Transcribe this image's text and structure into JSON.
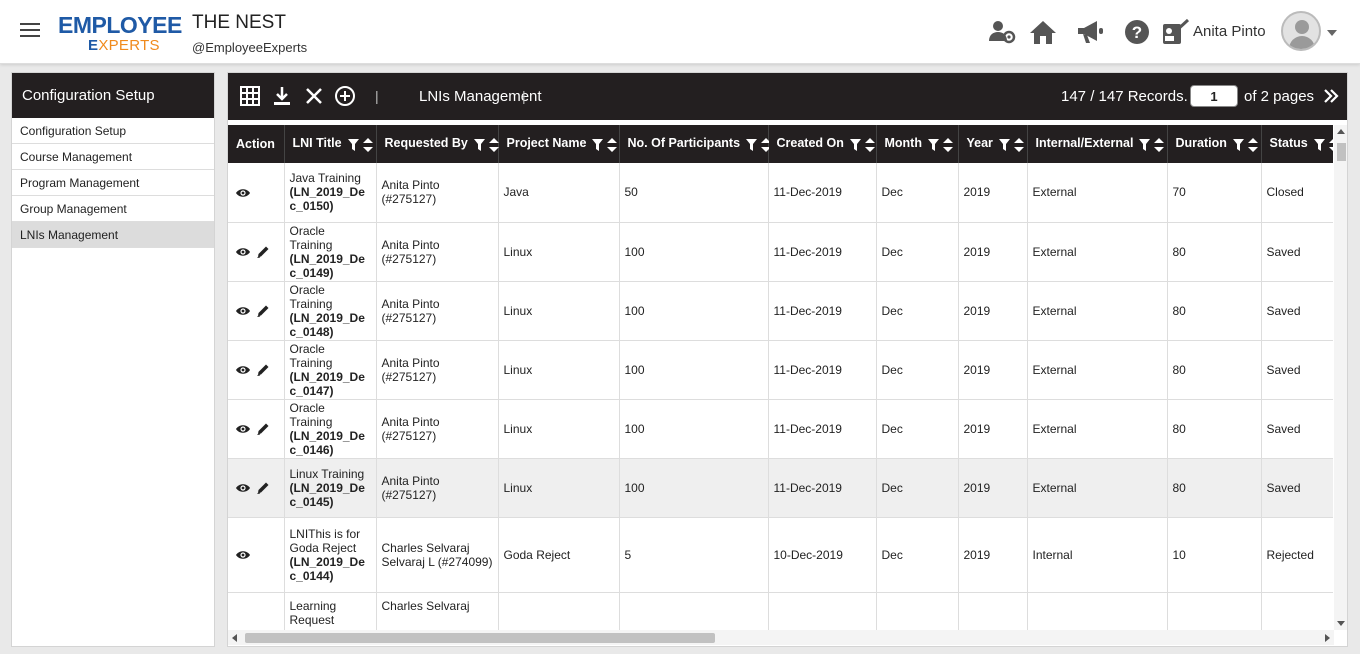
{
  "header": {
    "logo_line1": "EMPLOYEE",
    "logo_line2": "EXPERTS",
    "site_title": "THE NEST",
    "site_handle": "@EmployeeExperts",
    "user_name": "Anita Pinto"
  },
  "sidebar": {
    "title": "Configuration Setup",
    "items": [
      {
        "label": "Configuration Setup"
      },
      {
        "label": "Course Management"
      },
      {
        "label": "Program Management"
      },
      {
        "label": "Group Management"
      },
      {
        "label": "LNIs Management"
      }
    ],
    "active_index": 4
  },
  "toolbar": {
    "separator": "|",
    "title": "LNIs Management",
    "records": "147 / 147 Records.",
    "page_value": "1",
    "of_pages": "of 2 pages"
  },
  "table": {
    "columns": [
      "Action",
      "LNI Title",
      "Requested By",
      "Project Name",
      "No. Of Participants",
      "Created On",
      "Month",
      "Year",
      "Internal/External",
      "Duration",
      "Status"
    ],
    "rows": [
      {
        "title": "Java Training",
        "code": "(LN_2019_Dec_0150)",
        "requested_by": "Anita Pinto (#275127)",
        "project": "Java",
        "participants": "50",
        "created": "11-Dec-2019",
        "month": "Dec",
        "year": "2019",
        "type": "External",
        "duration": "70",
        "status": "Closed",
        "editable": false
      },
      {
        "title": "Oracle Training",
        "code": "(LN_2019_Dec_0149)",
        "requested_by": "Anita Pinto (#275127)",
        "project": "Linux",
        "participants": "100",
        "created": "11-Dec-2019",
        "month": "Dec",
        "year": "2019",
        "type": "External",
        "duration": "80",
        "status": "Saved",
        "editable": true
      },
      {
        "title": "Oracle Training",
        "code": "(LN_2019_Dec_0148)",
        "requested_by": "Anita Pinto (#275127)",
        "project": "Linux",
        "participants": "100",
        "created": "11-Dec-2019",
        "month": "Dec",
        "year": "2019",
        "type": "External",
        "duration": "80",
        "status": "Saved",
        "editable": true
      },
      {
        "title": "Oracle Training",
        "code": "(LN_2019_Dec_0147)",
        "requested_by": "Anita Pinto (#275127)",
        "project": "Linux",
        "participants": "100",
        "created": "11-Dec-2019",
        "month": "Dec",
        "year": "2019",
        "type": "External",
        "duration": "80",
        "status": "Saved",
        "editable": true
      },
      {
        "title": "Oracle Training",
        "code": "(LN_2019_Dec_0146)",
        "requested_by": "Anita Pinto (#275127)",
        "project": "Linux",
        "participants": "100",
        "created": "11-Dec-2019",
        "month": "Dec",
        "year": "2019",
        "type": "External",
        "duration": "80",
        "status": "Saved",
        "editable": true
      },
      {
        "title": "Linux Training",
        "code": "(LN_2019_Dec_0145)",
        "requested_by": "Anita Pinto (#275127)",
        "project": "Linux",
        "participants": "100",
        "created": "11-Dec-2019",
        "month": "Dec",
        "year": "2019",
        "type": "External",
        "duration": "80",
        "status": "Saved",
        "editable": true
      },
      {
        "title": "LNIThis is for Goda Reject",
        "code": "(LN_2019_Dec_0144)",
        "requested_by": "Charles Selvaraj Selvaraj L (#274099)",
        "project": "Goda Reject",
        "participants": "5",
        "created": "10-Dec-2019",
        "month": "Dec",
        "year": "2019",
        "type": "Internal",
        "duration": "10",
        "status": "Rejected",
        "editable": false
      },
      {
        "title": "Learning Request",
        "code": "",
        "requested_by": "Charles Selvaraj",
        "project": "",
        "participants": "",
        "created": "",
        "month": "",
        "year": "",
        "type": "",
        "duration": "",
        "status": "",
        "editable": false
      }
    ],
    "highlighted_row": 5
  },
  "colors": {
    "dark": "#231f20",
    "brand_blue": "#1f5aa6",
    "brand_orange": "#f08a1c"
  }
}
